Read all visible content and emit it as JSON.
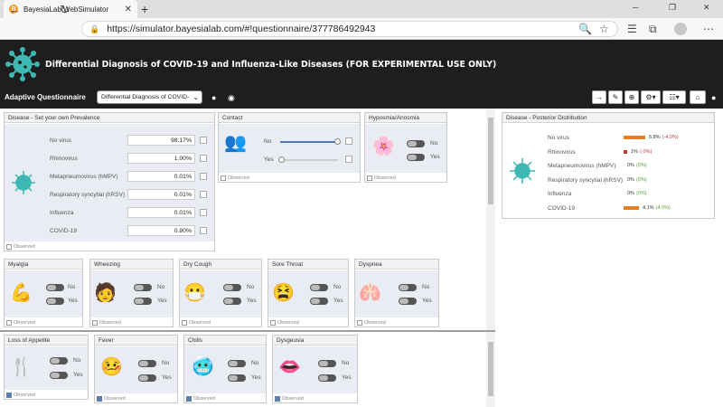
{
  "browser": {
    "tab_title": "BayesiaLab WebSimulator",
    "url": "https://simulator.bayesialab.com/#!questionnaire/377786492943"
  },
  "app": {
    "title": "Differential Diagnosis of COVID-19 and Influenza-Like Diseases (FOR EXPERIMENTAL USE ONLY)",
    "questionnaire_label": "Adaptive Questionnaire",
    "questionnaire_select": "Differential Diagnosis of COVID-"
  },
  "disease_panel": {
    "title": "Disease - Set your own Prevalence",
    "observed": "Observed",
    "rows": [
      {
        "label": "No virus",
        "value": "98.17%"
      },
      {
        "label": "Rhinovirus",
        "value": "1.00%"
      },
      {
        "label": "Metapneumovirus (hMPV)",
        "value": "0.01%"
      },
      {
        "label": "Respiratory syncytial (hRSV)",
        "value": "0.01%"
      },
      {
        "label": "Influenza",
        "value": "0.01%"
      },
      {
        "label": "COVID-19",
        "value": "0.80%"
      }
    ]
  },
  "contact": {
    "title": "Contact",
    "no": "No",
    "yes": "Yes",
    "observed": "Observed"
  },
  "symptoms": [
    {
      "title": "Hyposmia/Anosmia",
      "no": "No",
      "yes": "Yes",
      "observed": "Observed"
    },
    {
      "title": "Myalgia",
      "no": "No",
      "yes": "Yes",
      "observed": "Observed"
    },
    {
      "title": "Wheezing",
      "no": "No",
      "yes": "Yes",
      "observed": "Observed"
    },
    {
      "title": "Dry Cough",
      "no": "No",
      "yes": "Yes",
      "observed": "Observed"
    },
    {
      "title": "Sore Throat",
      "no": "No",
      "yes": "Yes",
      "observed": "Observed"
    },
    {
      "title": "Dyspnea",
      "no": "No",
      "yes": "Yes",
      "observed": "Observed"
    },
    {
      "title": "Loss of Appetite",
      "no": "No",
      "yes": "Yes",
      "observed": "Observed"
    },
    {
      "title": "Fever",
      "no": "No",
      "yes": "Yes",
      "observed": "Observed"
    },
    {
      "title": "Chills",
      "no": "No",
      "yes": "Yes",
      "observed": "Observed"
    },
    {
      "title": "Dysgeusia",
      "no": "No",
      "yes": "Yes",
      "observed": "Observed"
    }
  ],
  "posterior": {
    "title": "Disease - Posterior Distribution",
    "rows": [
      {
        "label": "No virus",
        "value": "5.8%",
        "delta": "(-4.0%)",
        "bar": 0.058
      },
      {
        "label": "Rhinovirus",
        "value": "1%",
        "delta": "(-0%)",
        "bar": 0.01
      },
      {
        "label": "Metapneumovirus (hMPV)",
        "value": "0%",
        "delta": "(0%)",
        "bar": 0
      },
      {
        "label": "Respiratory syncytial (hRSV)",
        "value": "0%",
        "delta": "(0%)",
        "bar": 0
      },
      {
        "label": "Influenza",
        "value": "0%",
        "delta": "(0%)",
        "bar": 0
      },
      {
        "label": "COVID-19",
        "value": "4.1%",
        "delta": "(4.0%)",
        "bar": 0.041
      }
    ]
  },
  "colors": {
    "header_bg": "#1e1e1e",
    "accent": "#4a79bd",
    "bar": "#e67e22",
    "virus": "#3fb8b4"
  }
}
